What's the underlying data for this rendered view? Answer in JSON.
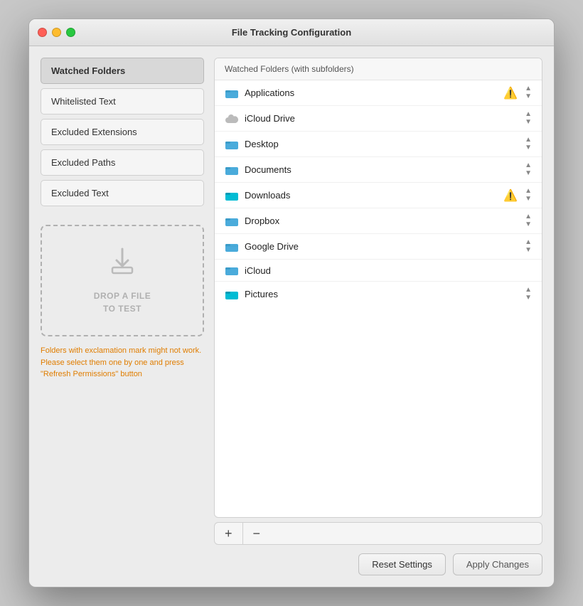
{
  "window": {
    "title": "File Tracking Configuration"
  },
  "buttons": {
    "close": "●",
    "minimize": "●",
    "maximize": "●"
  },
  "left_nav": {
    "items": [
      {
        "id": "watched-folders",
        "label": "Watched Folders",
        "active": true
      },
      {
        "id": "whitelisted-text",
        "label": "Whitelisted Text",
        "active": false
      },
      {
        "id": "excluded-extensions",
        "label": "Excluded Extensions",
        "active": false
      },
      {
        "id": "excluded-paths",
        "label": "Excluded Paths",
        "active": false
      },
      {
        "id": "excluded-text",
        "label": "Excluded Text",
        "active": false
      }
    ]
  },
  "drop_zone": {
    "text_line1": "DROP A FILE",
    "text_line2": "TO TEST"
  },
  "warning": {
    "text": "Folders with exclamation mark might not work. Please select them one by one and press \"Refresh Permissions\" button"
  },
  "right_panel": {
    "header": "Watched Folders (with subfolders)",
    "folders": [
      {
        "name": "Applications",
        "icon": "📂",
        "icon_type": "blue",
        "warning": true,
        "stepper": true
      },
      {
        "name": "iCloud Drive",
        "icon": "☁️",
        "icon_type": "gray",
        "warning": false,
        "stepper": true
      },
      {
        "name": "Desktop",
        "icon": "📁",
        "icon_type": "blue",
        "warning": false,
        "stepper": true
      },
      {
        "name": "Documents",
        "icon": "📁",
        "icon_type": "blue",
        "warning": false,
        "stepper": true
      },
      {
        "name": "Downloads",
        "icon": "📁",
        "icon_type": "cyan",
        "warning": true,
        "stepper": true
      },
      {
        "name": "Dropbox",
        "icon": "📁",
        "icon_type": "blue",
        "warning": false,
        "stepper": true
      },
      {
        "name": "Google Drive",
        "icon": "📂",
        "icon_type": "blue",
        "warning": false,
        "stepper": true
      },
      {
        "name": "iCloud",
        "icon": "📁",
        "icon_type": "blue",
        "warning": false,
        "stepper": false
      },
      {
        "name": "Pictures",
        "icon": "📁",
        "icon_type": "cyan",
        "warning": false,
        "stepper": true
      }
    ],
    "add_button": "+",
    "remove_button": "−"
  },
  "actions": {
    "reset_label": "Reset Settings",
    "apply_label": "Apply Changes"
  }
}
